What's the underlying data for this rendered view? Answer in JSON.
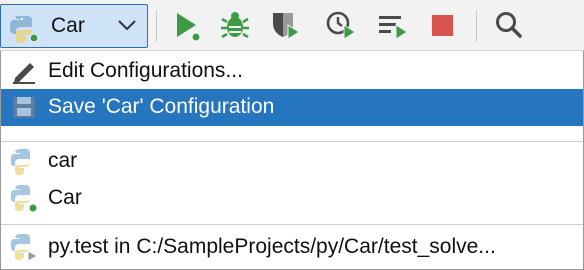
{
  "toolbar": {
    "config_name": "Car",
    "icons": [
      "python-icon",
      "chevron-down-icon",
      "run-icon",
      "debug-icon",
      "coverage-icon",
      "profile-icon",
      "concurrency-icon",
      "stop-icon",
      "search-icon"
    ],
    "colors": {
      "selection_border": "#2f6fb4",
      "selection_fill": "#cfe3f7",
      "run_green": "#3d9b46",
      "stop_red": "#d9534f"
    }
  },
  "menu": {
    "edit_configurations": "Edit Configurations...",
    "save_configuration": "Save 'Car' Configuration",
    "configs": [
      {
        "label": "car"
      },
      {
        "label": "Car"
      }
    ],
    "pytest_item": "py.test in C:/SampleProjects/py/Car/test_solve...",
    "colors": {
      "selected_bg": "#2675bf"
    }
  }
}
